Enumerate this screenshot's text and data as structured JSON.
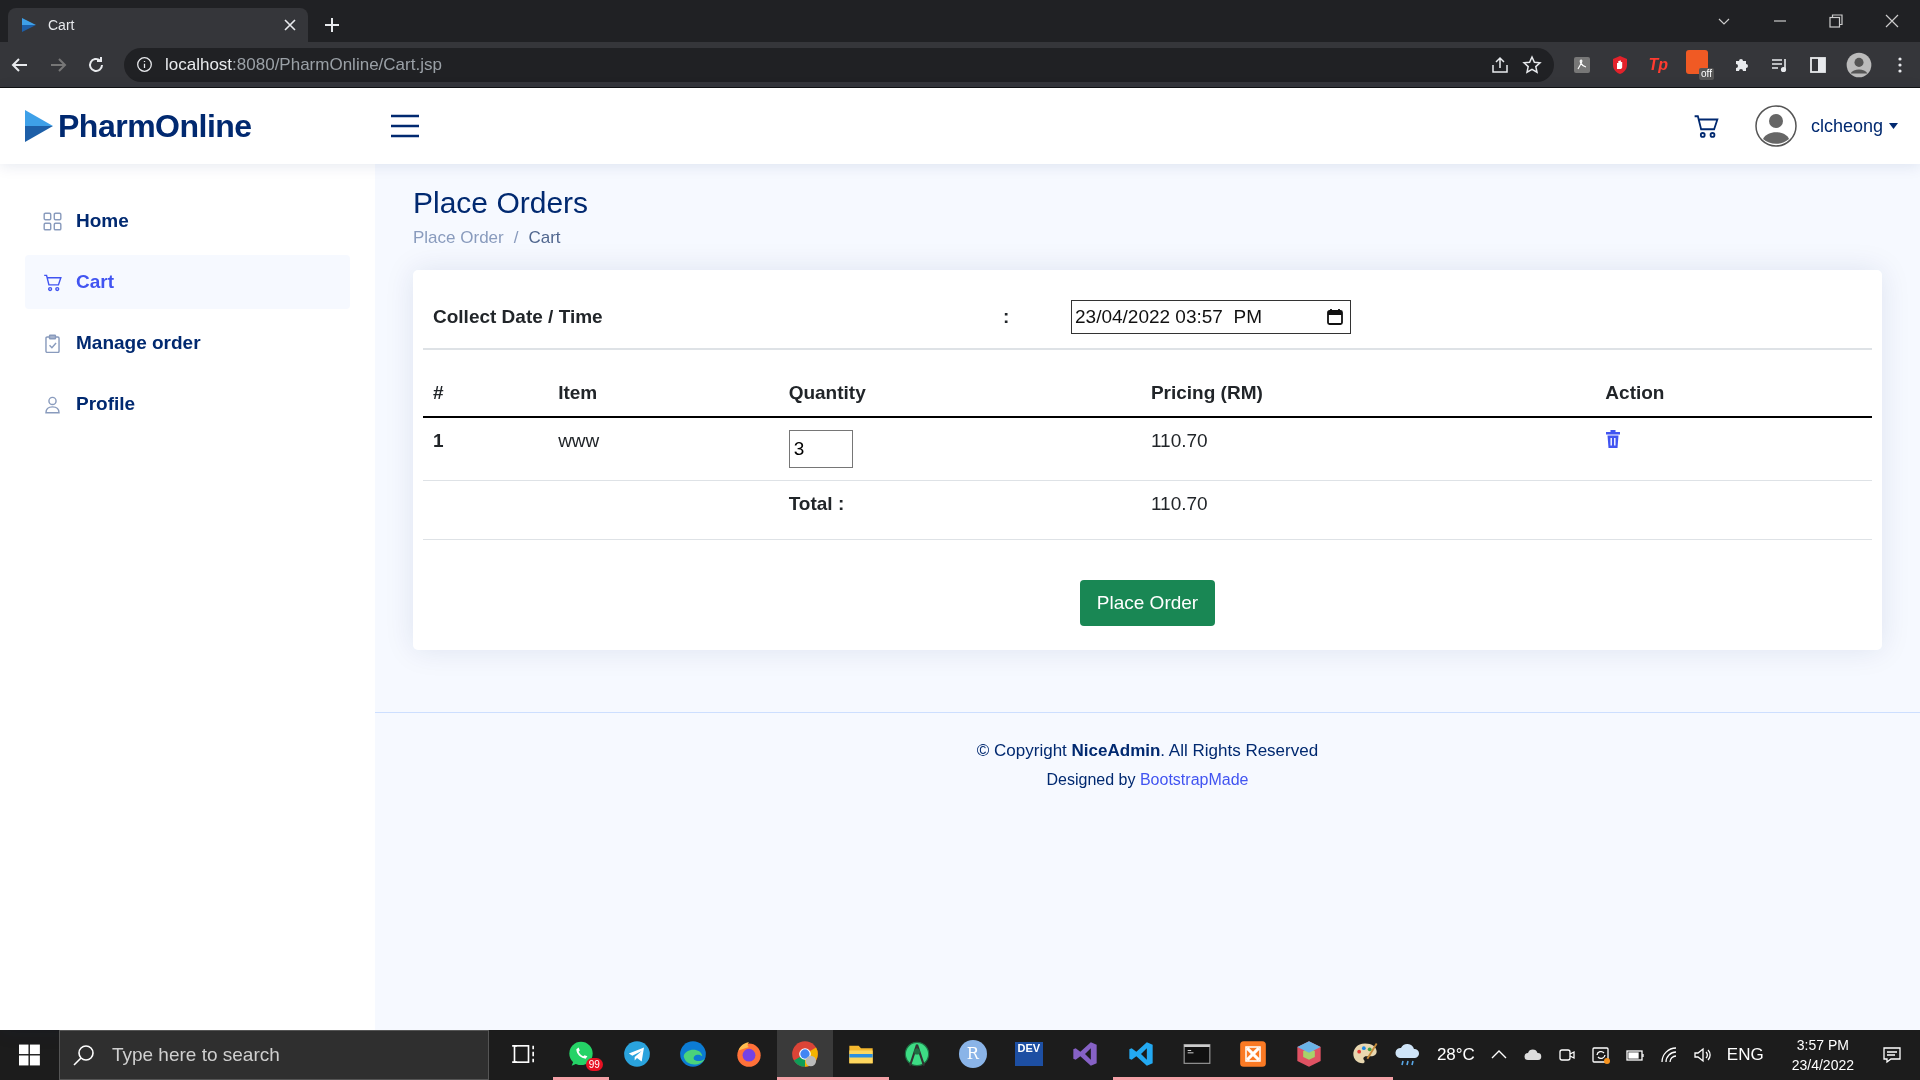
{
  "browser": {
    "tab": {
      "title": "Cart"
    },
    "url": {
      "host": "localhost",
      "path": ":8080/PharmOnline/Cart.jsp"
    },
    "extensions": [
      {
        "kind": "pdf"
      },
      {
        "kind": "hand"
      },
      {
        "kind": "tp",
        "label": "Tp"
      },
      {
        "kind": "off",
        "label": "off"
      },
      {
        "kind": "puzzle"
      },
      {
        "kind": "playlist"
      },
      {
        "kind": "sidepanel"
      },
      {
        "kind": "avatar"
      }
    ]
  },
  "header": {
    "logo": "PharmOnline",
    "user": "clcheong"
  },
  "sidebar": {
    "items": [
      {
        "label": "Home",
        "kind": "grid",
        "selected": false
      },
      {
        "label": "Cart",
        "kind": "cart",
        "selected": true
      },
      {
        "label": "Manage order",
        "kind": "clipboard",
        "selected": false
      },
      {
        "label": "Profile",
        "kind": "person",
        "selected": false
      }
    ]
  },
  "page": {
    "title": "Place Orders",
    "breadcrumb": [
      "Place Order",
      "Cart"
    ],
    "breadcrumb_separator": "/"
  },
  "collect": {
    "label": "Collect Date / Time",
    "separator": ":",
    "value": "23/04/2022 03:57  PM"
  },
  "table": {
    "columns": [
      "#",
      "Item",
      "Quantity",
      "Pricing (RM)",
      "Action"
    ],
    "rows": [
      {
        "index": "1",
        "item": "www",
        "quantity": "3",
        "price": "110.70"
      }
    ],
    "total": {
      "label": "Total :",
      "value": "110.70"
    }
  },
  "button": "Place Order",
  "footer": {
    "copyright": "© Copyright **NiceAdmin**. All Rights Reserved",
    "designed": "Designed by",
    "link": "BootstrapMade"
  },
  "taskbar": {
    "search": {
      "placeholder": "Type here to search"
    },
    "apps": [
      {
        "kind": "taskview",
        "running": false,
        "selected": false
      },
      {
        "kind": "whatsapp",
        "badge": "99",
        "running": true,
        "selected": false
      },
      {
        "kind": "telegram",
        "running": false,
        "selected": false
      },
      {
        "kind": "edge",
        "running": false,
        "selected": false
      },
      {
        "kind": "firefox",
        "running": false,
        "selected": false
      },
      {
        "kind": "chrome",
        "running": true,
        "selected": true
      },
      {
        "kind": "explorer",
        "running": true,
        "selected": false
      },
      {
        "kind": "android",
        "running": false,
        "selected": false
      },
      {
        "kind": "r",
        "label": "R",
        "running": false,
        "selected": false
      },
      {
        "kind": "devcpp",
        "label": "DEV",
        "running": false,
        "selected": false
      },
      {
        "kind": "vstudio",
        "running": false,
        "selected": false
      },
      {
        "kind": "vscode",
        "running": true,
        "selected": false
      },
      {
        "kind": "terminal",
        "running": true,
        "selected": false
      },
      {
        "kind": "xampp",
        "running": true,
        "selected": false
      },
      {
        "kind": "netbeans",
        "running": true,
        "selected": false
      },
      {
        "kind": "paint",
        "running": true,
        "selected": false
      }
    ],
    "weather": "28°C",
    "language": "ENG",
    "time": "3:57 PM",
    "date": "23/4/2022"
  }
}
